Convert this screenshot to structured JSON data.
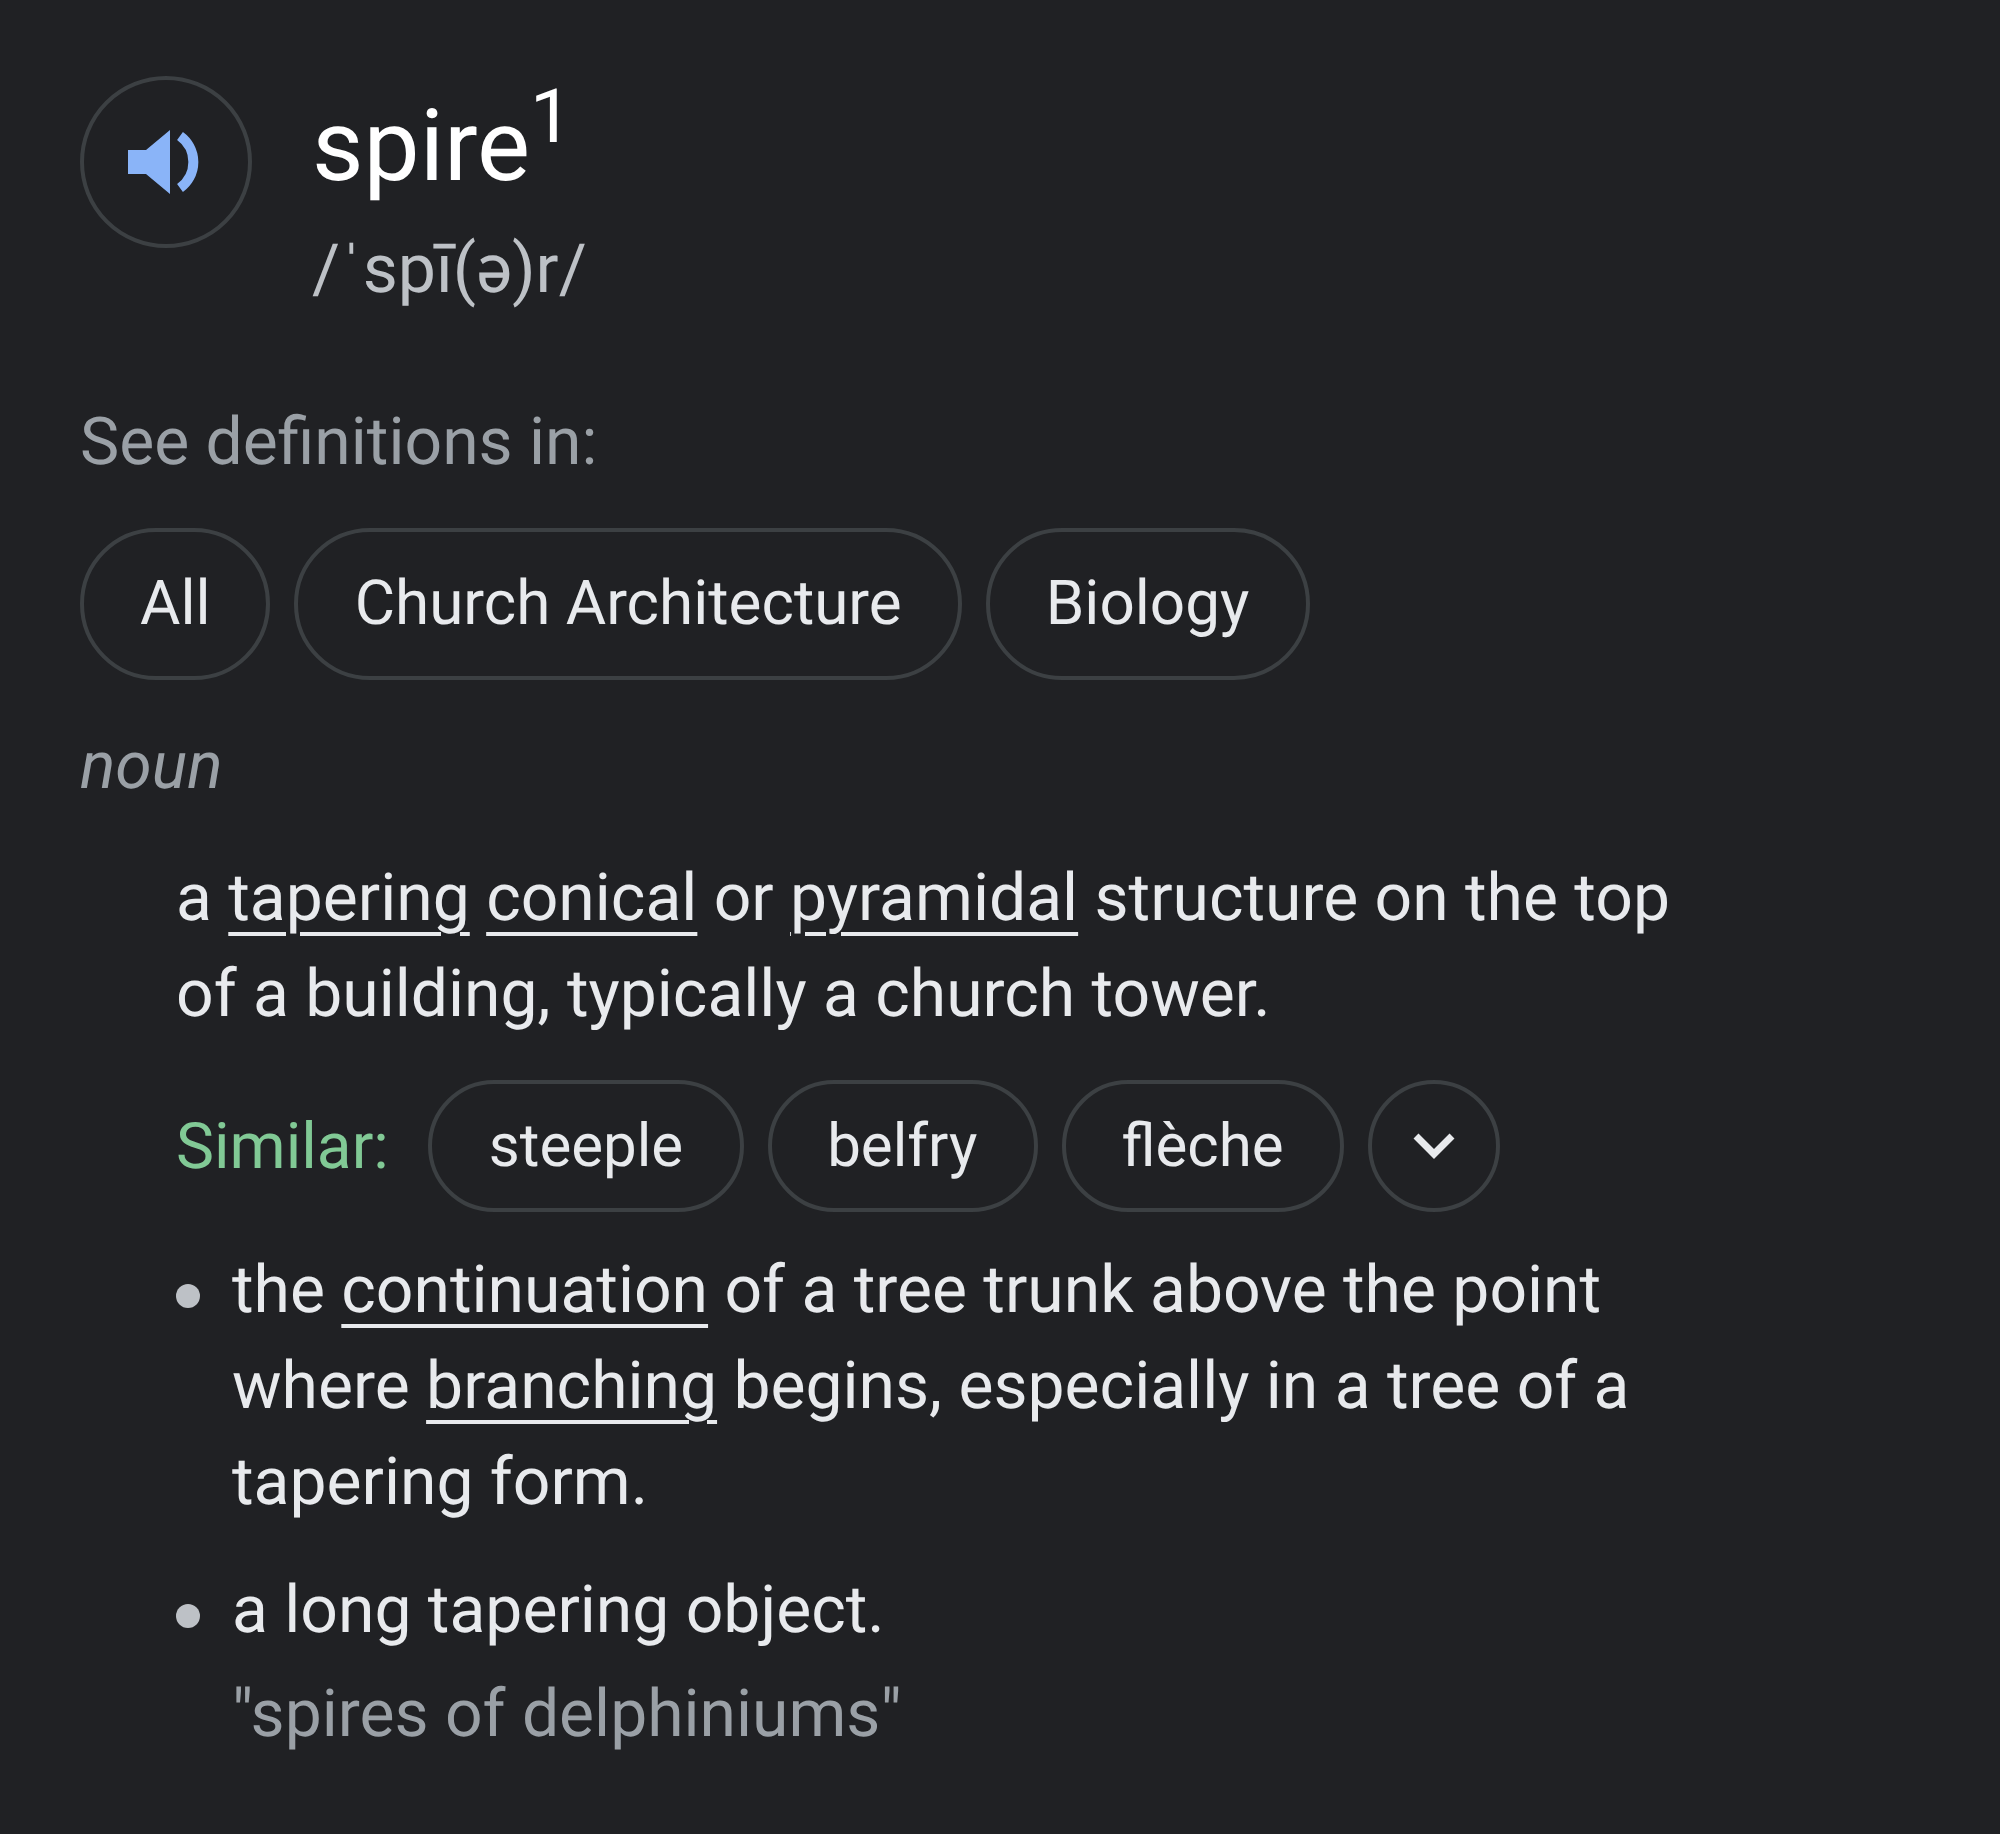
{
  "headword": "spire$^{1}$",
  "pronunciation": "/ˈspī(ə)r/",
  "see_definitions": {
    "label": "See definitions in:",
    "chips": [
      "All",
      "Church Architecture",
      "Biology"
    ]
  },
  "part_of_speech": "noun",
  "senses": [
    {
      "kind": "main",
      "segments": [
        {
          "text": "a "
        },
        {
          "text": "tapering",
          "link": true
        },
        {
          "text": "conical",
          "link": true
        },
        {
          "text": " or "
        },
        {
          "text": "pyramidal",
          "link": true
        },
        {
          "text": " structure on the top of a building, typically a church tower."
        }
      ],
      "similar": {
        "label": "Similar:",
        "chips": [
          "steeple",
          "belfry",
          "flèche"
        ]
      }
    },
    {
      "kind": "bullet",
      "segments": [
        {
          "text": "the "
        },
        {
          "text": "continuation",
          "link": true
        },
        {
          "text": " of a tree trunk above the point where "
        },
        {
          "text": "branching",
          "link": true
        },
        {
          "text": " begins, especially in a tree of a tapering form."
        }
      ]
    },
    {
      "kind": "bullet",
      "segments": [
        {
          "text": "a long tapering object."
        }
      ],
      "example": "\"spires of delphiniums\""
    }
  ]
}
